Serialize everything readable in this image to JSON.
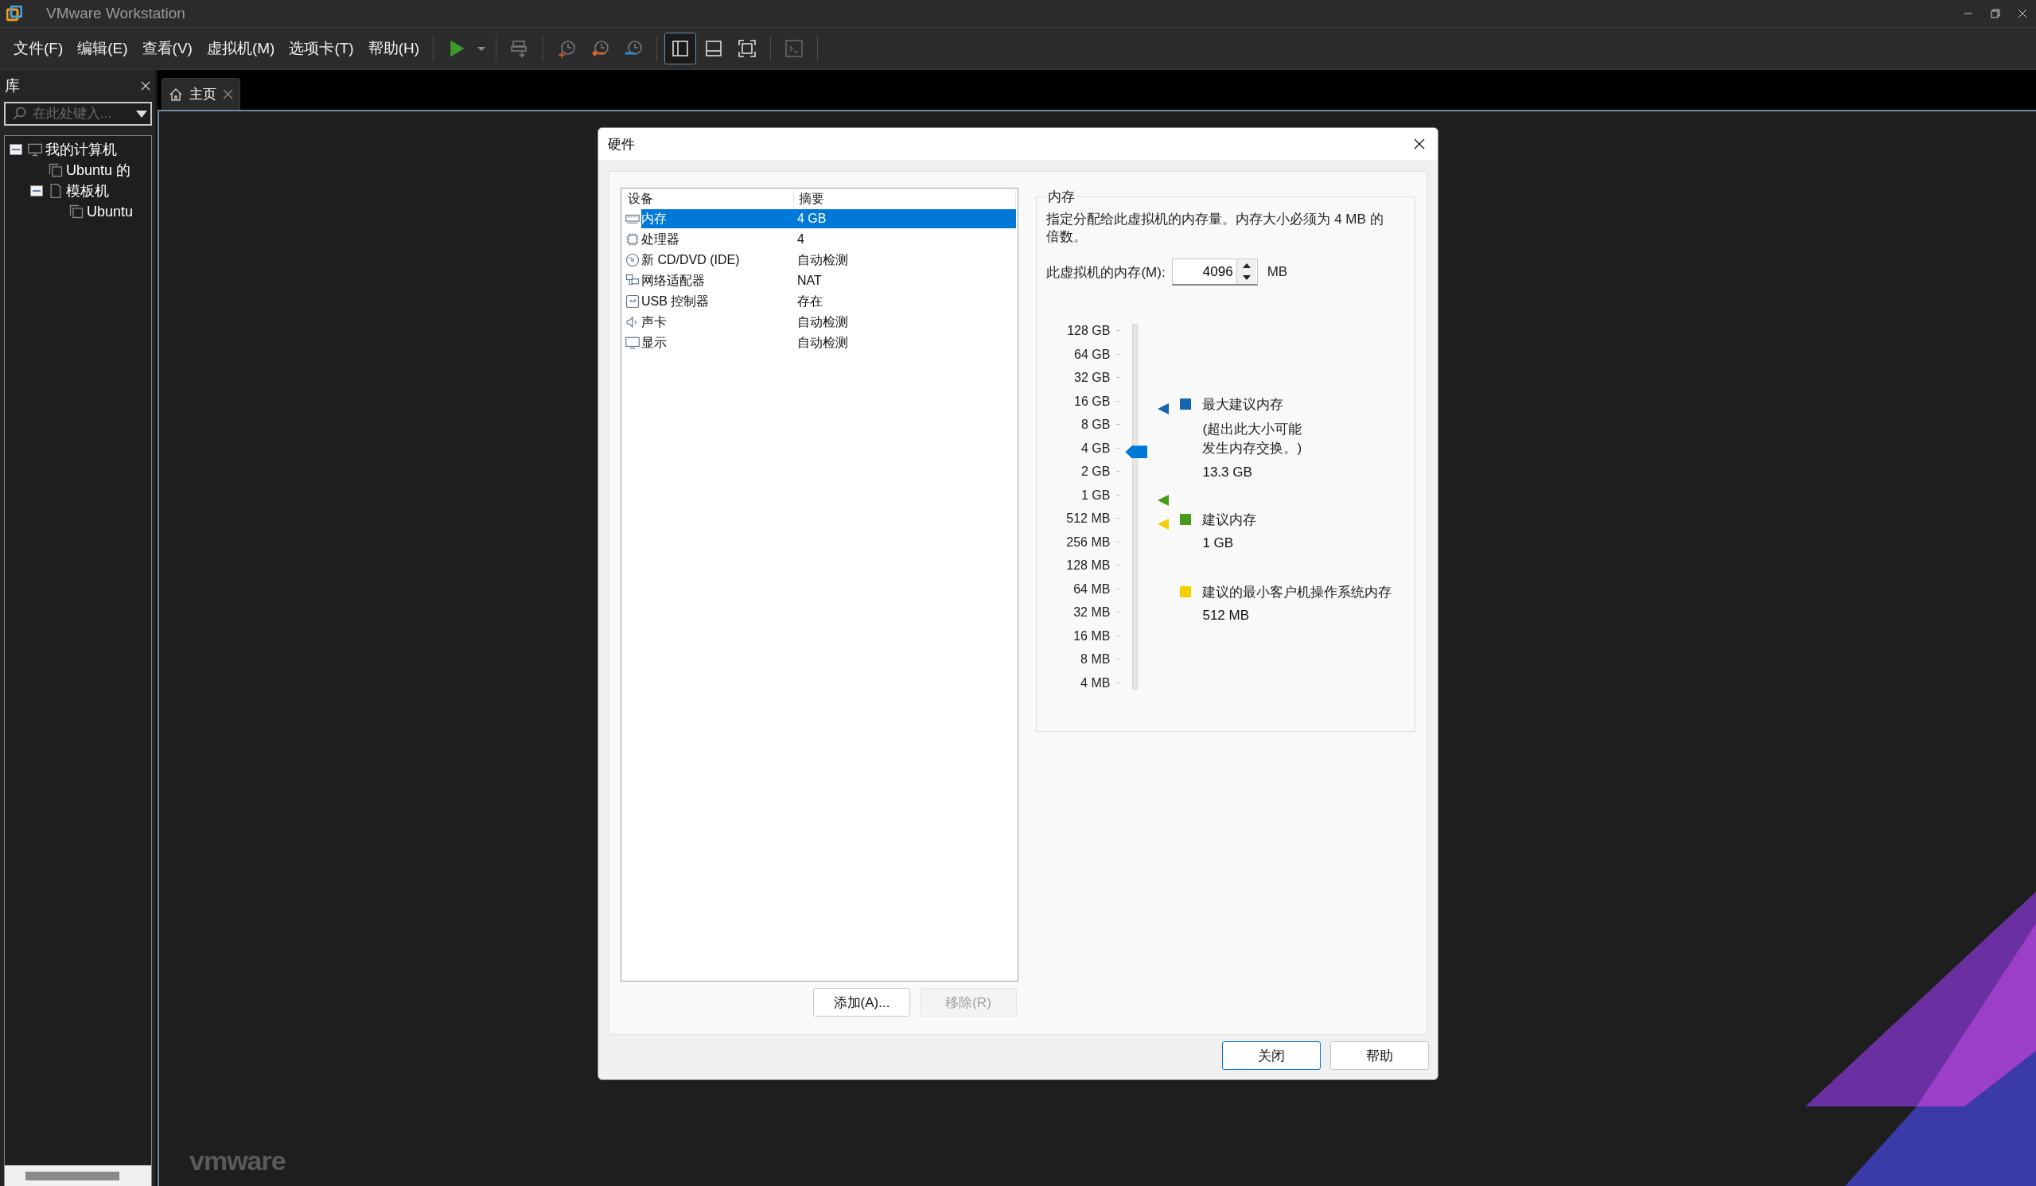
{
  "window": {
    "title": "VMware Workstation"
  },
  "menu": [
    "文件(F)",
    "编辑(E)",
    "查看(V)",
    "虚拟机(M)",
    "选项卡(T)",
    "帮助(H)"
  ],
  "toolbar": [
    [
      {
        "kind": "play"
      },
      {
        "kind": "caret"
      }
    ],
    [
      {
        "kind": "send-keys"
      }
    ],
    [
      {
        "kind": "snapshot-take"
      },
      {
        "kind": "snapshot-revert"
      },
      {
        "kind": "snapshot-manager"
      }
    ],
    [
      {
        "kind": "view-library",
        "selected": true
      },
      {
        "kind": "view-thumbnail",
        "selected": false
      },
      {
        "kind": "view-fullscreen",
        "selected": false
      }
    ],
    [
      {
        "kind": "console"
      }
    ]
  ],
  "library": {
    "title": "库",
    "search": {
      "placeholder": "在此处键入..."
    },
    "tree": [
      {
        "label": "我的计算机",
        "kind": "computer",
        "expanded": true,
        "children": [
          {
            "label": "Ubuntu 的",
            "kind": "vm"
          },
          {
            "label": "模板机",
            "kind": "folder",
            "expanded": true,
            "children": [
              {
                "label": "Ubuntu",
                "kind": "vm"
              }
            ]
          }
        ]
      }
    ]
  },
  "tabs": [
    {
      "label": "主页",
      "selected": true
    }
  ],
  "logo": "vmware",
  "dialog": {
    "title": "硬件",
    "devices": {
      "columns": [
        "设备",
        "摘要"
      ],
      "rows": [
        {
          "kind": "memory",
          "name": "内存",
          "summary": "4 GB",
          "selected": true
        },
        {
          "kind": "cpu",
          "name": "处理器",
          "summary": "4",
          "selected": false
        },
        {
          "kind": "cd",
          "name": "新 CD/DVD (IDE)",
          "summary": "自动检测",
          "selected": false
        },
        {
          "kind": "network",
          "name": "网络适配器",
          "summary": "NAT",
          "selected": false
        },
        {
          "kind": "usb",
          "name": "USB 控制器",
          "summary": "存在",
          "selected": false
        },
        {
          "kind": "sound",
          "name": "声卡",
          "summary": "自动检测",
          "selected": false
        },
        {
          "kind": "display",
          "name": "显示",
          "summary": "自动检测",
          "selected": false
        }
      ]
    },
    "add_button": {
      "label": "添加(A)...",
      "disabled": false
    },
    "remove_button": {
      "label": "移除(R)",
      "disabled": true
    },
    "memory": {
      "title": "内存",
      "description": "指定分配给此虚拟机的内存量。内存大小必须为 4 MB 的倍数。",
      "field_label": "此虚拟机的内存(M):",
      "value": "4096",
      "unit": "MB",
      "ticks": [
        "128 GB",
        "64 GB",
        "32 GB",
        "16 GB",
        "8 GB",
        "4 GB",
        "2 GB",
        "1 GB",
        "512 MB",
        "256 MB",
        "128 MB",
        "64 MB",
        "32 MB",
        "16 MB",
        "8 MB",
        "4 MB"
      ],
      "level": 0.667,
      "markers": [
        {
          "color": "#1565b0",
          "level": 0.782
        },
        {
          "color": "#4a9a1a",
          "level": 0.533
        },
        {
          "color": "#f5d000",
          "level": 0.467
        }
      ],
      "legend": [
        {
          "label": "最大建议内存",
          "note": "(超出此大小可能发生内存交换。)",
          "value": "13.3 GB",
          "color": "#1565b0"
        },
        {
          "label": "建议内存",
          "value": "1 GB",
          "color": "#4a9a1a"
        },
        {
          "label": "建议的最小客户机操作系统内存",
          "value": "512 MB",
          "color": "#f5d000"
        }
      ]
    },
    "buttons": [
      {
        "label": "关闭",
        "default": true
      },
      {
        "label": "帮助",
        "default": false
      }
    ]
  }
}
